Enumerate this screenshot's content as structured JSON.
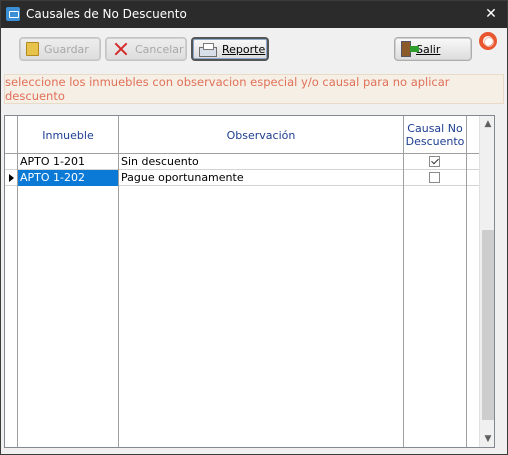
{
  "window": {
    "title": "Causales de No Descuento",
    "close_glyph": "✕"
  },
  "toolbar": {
    "save_label": "Guardar",
    "cancel_label": "Cancelar",
    "report_label": "Reporte",
    "exit_label": "Salir"
  },
  "notice": "seleccione los inmuebles con observacion especial y/o causal para no aplicar descuento",
  "grid": {
    "columns": [
      "Inmueble",
      "Observación",
      "Causal No Descuento"
    ],
    "rows": [
      {
        "inmueble": "APTO 1-201",
        "observacion": "Sin descuento",
        "causal": true
      },
      {
        "inmueble": "APTO 1-202",
        "observacion": "Pague oportunamente",
        "causal": false
      }
    ]
  },
  "colors": {
    "title_bar": "#2b2b2b",
    "header_text": "#1d3d8f",
    "notice_text": "#e07058",
    "selection": "#0b7ad6"
  }
}
